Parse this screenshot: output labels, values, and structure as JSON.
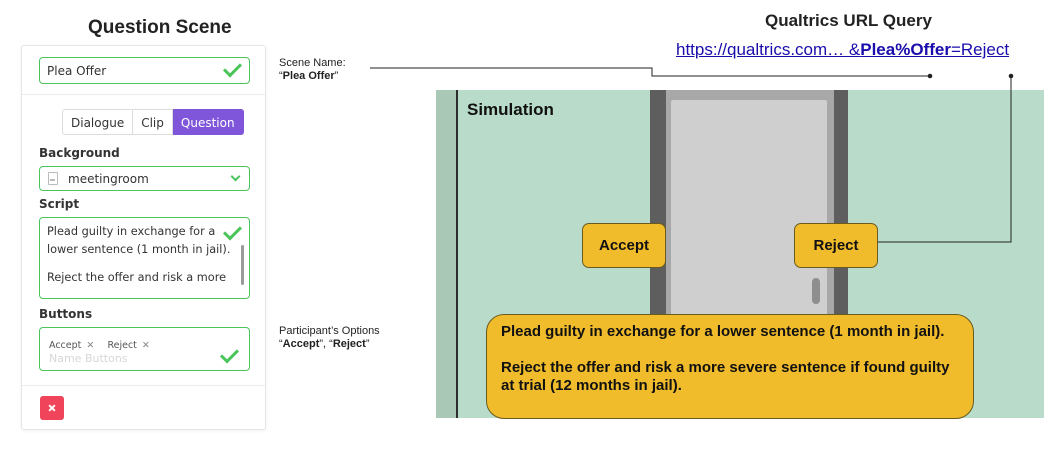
{
  "panel": {
    "title": "Question Scene",
    "scene_name": "Plea Offer",
    "tabs": [
      {
        "label": "Dialogue",
        "active": false
      },
      {
        "label": "Clip",
        "active": false
      },
      {
        "label": "Question",
        "active": true
      }
    ],
    "background_label": "Background",
    "background_value": "meetingroom",
    "script_label": "Script",
    "script_lines": [
      "Plead guilty in exchange for a lower sentence (1 month in jail).",
      "Reject the offer and risk a more"
    ],
    "buttons_label": "Buttons",
    "button_tags": [
      "Accept",
      "Reject"
    ],
    "buttons_placeholder": "Name Buttons"
  },
  "annotations": {
    "scene_name_label": "Scene Name:",
    "scene_name_value": "“Plea Offer”",
    "options_label": "Participant’s Options",
    "options_accept": "Accept",
    "options_reject": "Reject"
  },
  "qualtrics": {
    "title": "Qualtrics URL Query",
    "url_prefix": "https://qualtrics.com… &",
    "url_key": "Plea%Offer",
    "url_suffix": "=Reject"
  },
  "simulation": {
    "title": "Simulation",
    "accept_label": "Accept",
    "reject_label": "Reject",
    "text_lines": [
      "Plead guilty in exchange for a lower sentence (1 month in jail).",
      "Reject the offer and risk a more severe sentence if found guilty at trial (12 months in jail)."
    ]
  },
  "colors": {
    "valid_green": "#4cc45c",
    "active_tab": "#7f56d9",
    "delete_red": "#f0445a",
    "sim_button_yellow": "#f0bc2c",
    "sim_wall": "#b8dcc9",
    "url_blue": "#1a0dab"
  },
  "icons": [
    "checkmark-icon",
    "file-icon",
    "chevron-down-icon",
    "close-icon"
  ]
}
